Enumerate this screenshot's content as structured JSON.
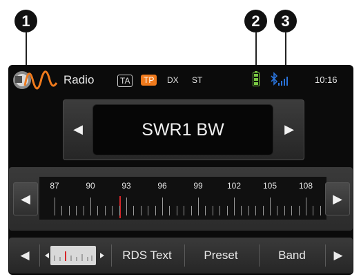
{
  "callouts": [
    "1",
    "2",
    "3"
  ],
  "status": {
    "app_title": "Radio",
    "tags": [
      "TA",
      "TP",
      "DX",
      "ST"
    ],
    "active_tag": "TP",
    "clock": "10:16"
  },
  "station": {
    "name": "SWR1 BW"
  },
  "tuner": {
    "scale_labels": [
      "87",
      "90",
      "93",
      "96",
      "99",
      "102",
      "105",
      "108"
    ]
  },
  "bottom": {
    "rds_text": "RDS Text",
    "preset": "Preset",
    "band": "Band"
  },
  "colors": {
    "accent_orange": "#f07a1c",
    "needle_red": "#d7262a",
    "bluetooth_blue": "#2a73d9",
    "battery_green": "#7ac943"
  }
}
